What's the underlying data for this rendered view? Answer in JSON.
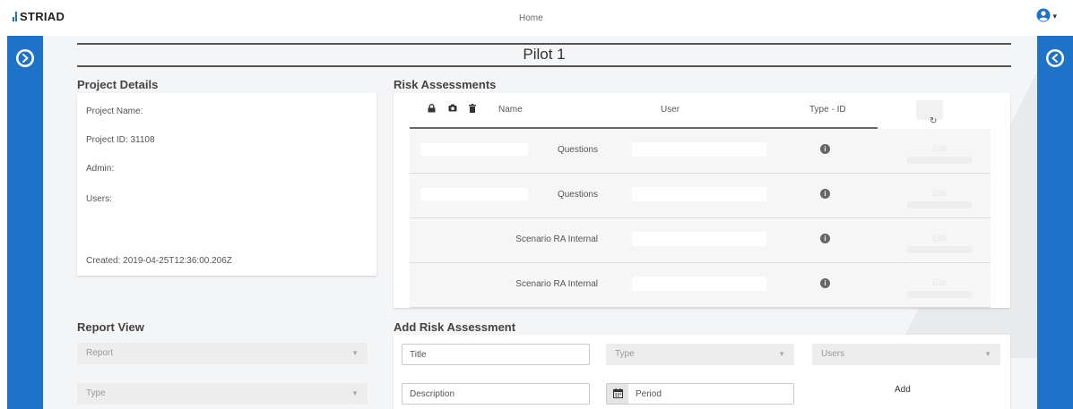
{
  "header": {
    "brand": "STRIAD",
    "nav_home": "Home",
    "user_caret": "▾"
  },
  "page": {
    "title": "Pilot 1"
  },
  "project_details": {
    "heading": "Project Details",
    "name_label": "Project Name:",
    "id_label": "Project ID: 31108",
    "admin_label": "Admin:",
    "users_label": "Users:",
    "created_label": "Created: 2019-04-25T12:36:00.206Z"
  },
  "risk_assessments": {
    "heading": "Risk Assessments",
    "columns": {
      "name": "Name",
      "user": "User",
      "type_id": "Type - ID"
    },
    "rows": [
      {
        "name": "Questions",
        "edit": "Edit"
      },
      {
        "name": "Questions",
        "edit": "Edit"
      },
      {
        "name": "Scenario RA Internal",
        "edit": "Edit"
      },
      {
        "name": "Scenario RA Internal",
        "edit": "Edit"
      }
    ]
  },
  "report_view": {
    "heading": "Report View",
    "report_select": "Report",
    "type_select": "Type"
  },
  "add_risk_assessment": {
    "heading": "Add Risk Assessment",
    "title_placeholder": "Title",
    "type_select": "Type",
    "users_select": "Users",
    "description_placeholder": "Description",
    "period_placeholder": "Period",
    "add_button": "Add"
  },
  "colors": {
    "brand_blue": "#1e73c8",
    "background": "#f4f5f7"
  }
}
